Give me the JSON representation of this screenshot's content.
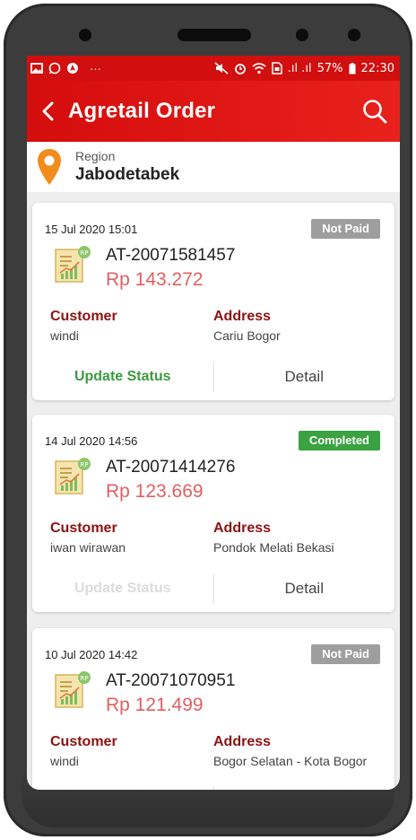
{
  "statusbar": {
    "left_icons": [
      "image-icon",
      "whatsapp-icon",
      "navigation-icon",
      "more-icon"
    ],
    "more": "···",
    "signal_text": ".ıl .ıl",
    "battery": "57%",
    "time": "22:30"
  },
  "appbar": {
    "title": "Agretail Order"
  },
  "region": {
    "label": "Region",
    "value": "Jabodetabek"
  },
  "labels": {
    "customer": "Customer",
    "address": "Address",
    "update_status": "Update Status",
    "detail": "Detail"
  },
  "orders": [
    {
      "date": "15 Jul 2020 15:01",
      "status": "Not Paid",
      "id": "AT-20071581457",
      "amount": "Rp 143.272",
      "customer": "windi",
      "address": "Cariu Bogor",
      "update_enabled": true
    },
    {
      "date": "14 Jul 2020 14:56",
      "status": "Completed",
      "id": "AT-20071414276",
      "amount": "Rp 123.669",
      "customer": "iwan wirawan",
      "address": "Pondok Melati Bekasi",
      "update_enabled": false
    },
    {
      "date": "10 Jul 2020 14:42",
      "status": "Not Paid",
      "id": "AT-20071070951",
      "amount": "Rp 121.499",
      "customer": "windi",
      "address": "Bogor Selatan - Kota Bogor",
      "update_enabled": true
    }
  ],
  "colors": {
    "brand_red": "#d10f0f",
    "amount": "#e06060",
    "label": "#8e1212",
    "completed": "#3aa241",
    "not_paid": "#9e9e9e",
    "update": "#3a9a3f"
  }
}
